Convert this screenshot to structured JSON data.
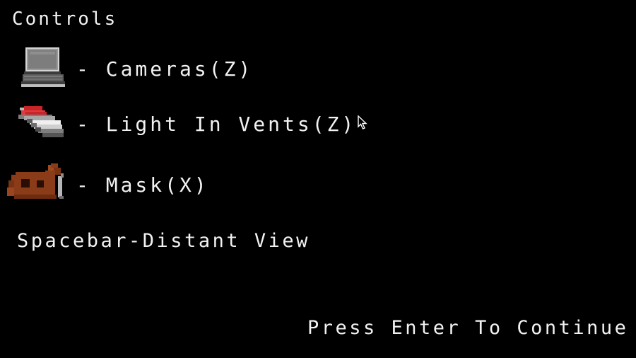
{
  "screen": {
    "title": "Controls",
    "controls": [
      {
        "icon": "laptop-icon",
        "label": "- Cameras(Z)"
      },
      {
        "icon": "flashlight-icon",
        "label": "- Light In Vents(Z)"
      },
      {
        "icon": "mask-icon",
        "label": "- Mask(X)"
      }
    ],
    "spacebar_hint": "Spacebar-Distant View",
    "continue_prompt": "Press Enter To Continue"
  },
  "colors": {
    "background": "#000000",
    "text": "#f2f2f2",
    "mask_brown": "#8a3b17",
    "light_red": "#c8242a"
  }
}
